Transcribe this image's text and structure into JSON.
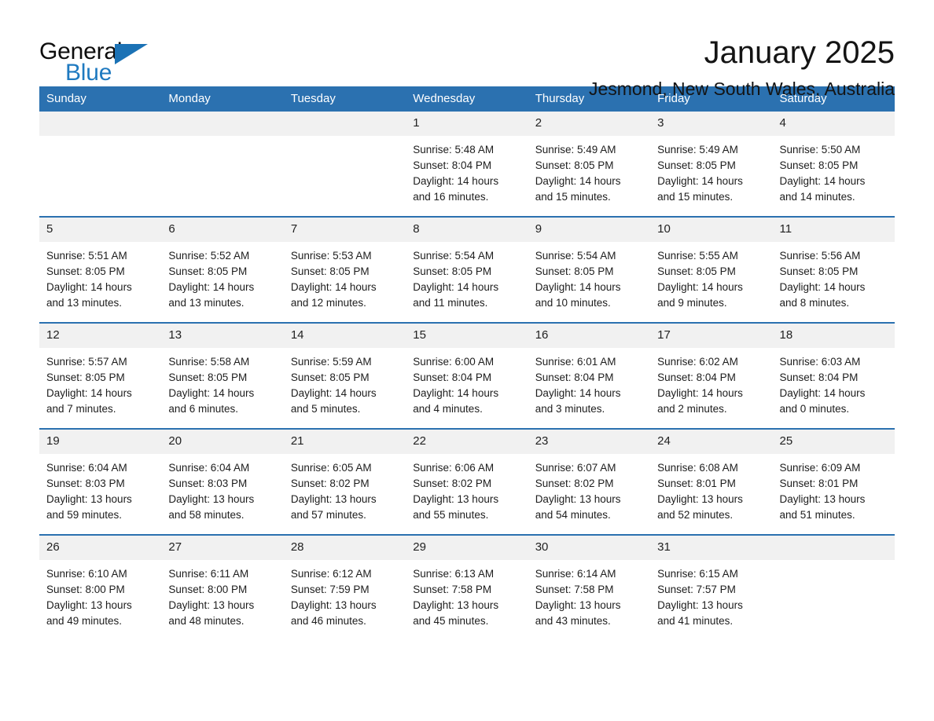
{
  "brand": {
    "name_part1": "General",
    "name_part2": "Blue",
    "triangle_icon": "triangle-logo-icon",
    "color_blue": "#1b72b5",
    "color_text": "#0d0d0d"
  },
  "header": {
    "title": "January 2025",
    "subtitle": "Jesmond, New South Wales, Australia"
  },
  "theme": {
    "header_row_bg": "#2b71b0",
    "header_row_text": "#ffffff",
    "daynum_bg": "#f1f1f1",
    "row_separator": "#2b71b0",
    "page_bg": "#ffffff"
  },
  "calendar": {
    "weekday_headers": [
      "Sunday",
      "Monday",
      "Tuesday",
      "Wednesday",
      "Thursday",
      "Friday",
      "Saturday"
    ],
    "weeks": [
      [
        {
          "day": "",
          "lines": []
        },
        {
          "day": "",
          "lines": []
        },
        {
          "day": "",
          "lines": []
        },
        {
          "day": "1",
          "lines": [
            "Sunrise: 5:48 AM",
            "Sunset: 8:04 PM",
            "Daylight: 14 hours",
            "and 16 minutes."
          ]
        },
        {
          "day": "2",
          "lines": [
            "Sunrise: 5:49 AM",
            "Sunset: 8:05 PM",
            "Daylight: 14 hours",
            "and 15 minutes."
          ]
        },
        {
          "day": "3",
          "lines": [
            "Sunrise: 5:49 AM",
            "Sunset: 8:05 PM",
            "Daylight: 14 hours",
            "and 15 minutes."
          ]
        },
        {
          "day": "4",
          "lines": [
            "Sunrise: 5:50 AM",
            "Sunset: 8:05 PM",
            "Daylight: 14 hours",
            "and 14 minutes."
          ]
        }
      ],
      [
        {
          "day": "5",
          "lines": [
            "Sunrise: 5:51 AM",
            "Sunset: 8:05 PM",
            "Daylight: 14 hours",
            "and 13 minutes."
          ]
        },
        {
          "day": "6",
          "lines": [
            "Sunrise: 5:52 AM",
            "Sunset: 8:05 PM",
            "Daylight: 14 hours",
            "and 13 minutes."
          ]
        },
        {
          "day": "7",
          "lines": [
            "Sunrise: 5:53 AM",
            "Sunset: 8:05 PM",
            "Daylight: 14 hours",
            "and 12 minutes."
          ]
        },
        {
          "day": "8",
          "lines": [
            "Sunrise: 5:54 AM",
            "Sunset: 8:05 PM",
            "Daylight: 14 hours",
            "and 11 minutes."
          ]
        },
        {
          "day": "9",
          "lines": [
            "Sunrise: 5:54 AM",
            "Sunset: 8:05 PM",
            "Daylight: 14 hours",
            "and 10 minutes."
          ]
        },
        {
          "day": "10",
          "lines": [
            "Sunrise: 5:55 AM",
            "Sunset: 8:05 PM",
            "Daylight: 14 hours",
            "and 9 minutes."
          ]
        },
        {
          "day": "11",
          "lines": [
            "Sunrise: 5:56 AM",
            "Sunset: 8:05 PM",
            "Daylight: 14 hours",
            "and 8 minutes."
          ]
        }
      ],
      [
        {
          "day": "12",
          "lines": [
            "Sunrise: 5:57 AM",
            "Sunset: 8:05 PM",
            "Daylight: 14 hours",
            "and 7 minutes."
          ]
        },
        {
          "day": "13",
          "lines": [
            "Sunrise: 5:58 AM",
            "Sunset: 8:05 PM",
            "Daylight: 14 hours",
            "and 6 minutes."
          ]
        },
        {
          "day": "14",
          "lines": [
            "Sunrise: 5:59 AM",
            "Sunset: 8:05 PM",
            "Daylight: 14 hours",
            "and 5 minutes."
          ]
        },
        {
          "day": "15",
          "lines": [
            "Sunrise: 6:00 AM",
            "Sunset: 8:04 PM",
            "Daylight: 14 hours",
            "and 4 minutes."
          ]
        },
        {
          "day": "16",
          "lines": [
            "Sunrise: 6:01 AM",
            "Sunset: 8:04 PM",
            "Daylight: 14 hours",
            "and 3 minutes."
          ]
        },
        {
          "day": "17",
          "lines": [
            "Sunrise: 6:02 AM",
            "Sunset: 8:04 PM",
            "Daylight: 14 hours",
            "and 2 minutes."
          ]
        },
        {
          "day": "18",
          "lines": [
            "Sunrise: 6:03 AM",
            "Sunset: 8:04 PM",
            "Daylight: 14 hours",
            "and 0 minutes."
          ]
        }
      ],
      [
        {
          "day": "19",
          "lines": [
            "Sunrise: 6:04 AM",
            "Sunset: 8:03 PM",
            "Daylight: 13 hours",
            "and 59 minutes."
          ]
        },
        {
          "day": "20",
          "lines": [
            "Sunrise: 6:04 AM",
            "Sunset: 8:03 PM",
            "Daylight: 13 hours",
            "and 58 minutes."
          ]
        },
        {
          "day": "21",
          "lines": [
            "Sunrise: 6:05 AM",
            "Sunset: 8:02 PM",
            "Daylight: 13 hours",
            "and 57 minutes."
          ]
        },
        {
          "day": "22",
          "lines": [
            "Sunrise: 6:06 AM",
            "Sunset: 8:02 PM",
            "Daylight: 13 hours",
            "and 55 minutes."
          ]
        },
        {
          "day": "23",
          "lines": [
            "Sunrise: 6:07 AM",
            "Sunset: 8:02 PM",
            "Daylight: 13 hours",
            "and 54 minutes."
          ]
        },
        {
          "day": "24",
          "lines": [
            "Sunrise: 6:08 AM",
            "Sunset: 8:01 PM",
            "Daylight: 13 hours",
            "and 52 minutes."
          ]
        },
        {
          "day": "25",
          "lines": [
            "Sunrise: 6:09 AM",
            "Sunset: 8:01 PM",
            "Daylight: 13 hours",
            "and 51 minutes."
          ]
        }
      ],
      [
        {
          "day": "26",
          "lines": [
            "Sunrise: 6:10 AM",
            "Sunset: 8:00 PM",
            "Daylight: 13 hours",
            "and 49 minutes."
          ]
        },
        {
          "day": "27",
          "lines": [
            "Sunrise: 6:11 AM",
            "Sunset: 8:00 PM",
            "Daylight: 13 hours",
            "and 48 minutes."
          ]
        },
        {
          "day": "28",
          "lines": [
            "Sunrise: 6:12 AM",
            "Sunset: 7:59 PM",
            "Daylight: 13 hours",
            "and 46 minutes."
          ]
        },
        {
          "day": "29",
          "lines": [
            "Sunrise: 6:13 AM",
            "Sunset: 7:58 PM",
            "Daylight: 13 hours",
            "and 45 minutes."
          ]
        },
        {
          "day": "30",
          "lines": [
            "Sunrise: 6:14 AM",
            "Sunset: 7:58 PM",
            "Daylight: 13 hours",
            "and 43 minutes."
          ]
        },
        {
          "day": "31",
          "lines": [
            "Sunrise: 6:15 AM",
            "Sunset: 7:57 PM",
            "Daylight: 13 hours",
            "and 41 minutes."
          ]
        },
        {
          "day": "",
          "lines": []
        }
      ]
    ]
  }
}
